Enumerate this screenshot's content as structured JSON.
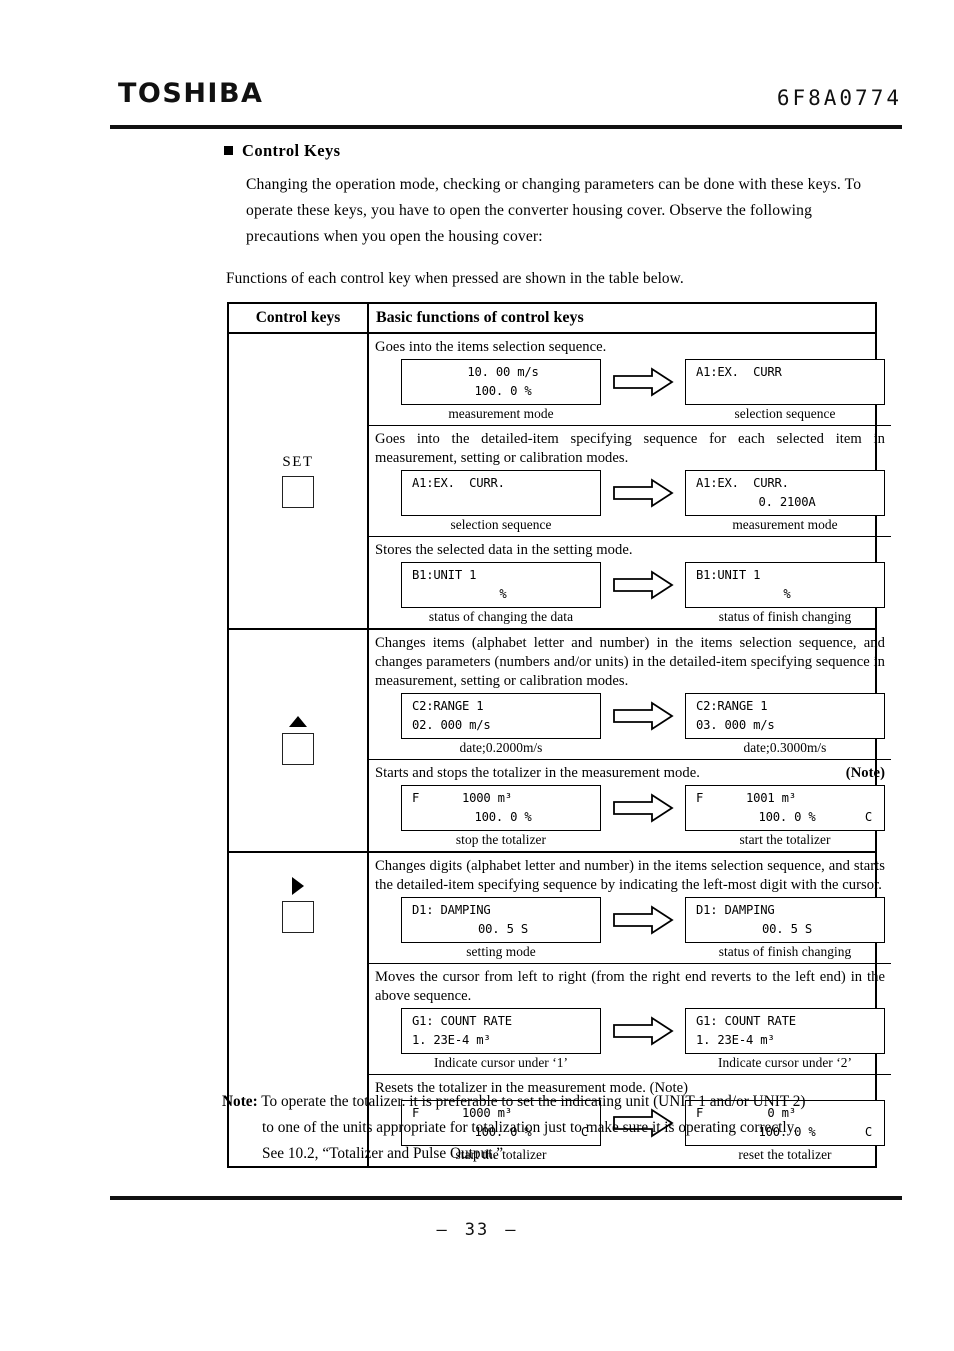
{
  "header": {
    "brand": "TOSHIBA",
    "doc_code": "6F8A0774"
  },
  "footer": {
    "page_number": "33",
    "dash_left": "—",
    "dash_right": "—"
  },
  "section": {
    "title": "Control Keys",
    "paragraph": "Changing the operation mode, checking or changing parameters can be done with these keys. To operate these keys, you have to open the converter housing cover. Observe the following precautions when you open the housing cover:",
    "lead_in": "Functions of each control key when pressed are shown in the table below."
  },
  "table": {
    "headers": {
      "left": "Control keys",
      "right": "Basic functions of control keys"
    },
    "rows": [
      {
        "key": {
          "label": "SET",
          "glyph": "box"
        },
        "subrows": [
          {
            "description": "Goes into the items selection sequence.",
            "note_tag": "",
            "before": {
              "line1": "10. 00 m/s",
              "line2": "100. 0 %",
              "indicator": "",
              "caption": "measurement mode"
            },
            "after": {
              "line1": "A1:EX.  CURR",
              "line2": "",
              "indicator": "",
              "caption": "selection sequence"
            }
          },
          {
            "description": "Goes into the detailed-item specifying sequence for each selected item in measurement, setting or calibration modes.",
            "note_tag": "",
            "before": {
              "line1": "A1:EX.  CURR.",
              "line2": "",
              "indicator": "",
              "caption": "selection sequence"
            },
            "after": {
              "line1": "A1:EX.  CURR.",
              "line2": "0. 2100A",
              "indicator": "",
              "caption": "measurement mode"
            }
          },
          {
            "description": "Stores the selected data in the setting mode.",
            "note_tag": "",
            "before": {
              "line1": "B1:UNIT 1",
              "line2": "%",
              "indicator": "",
              "caption": "status of changing the data"
            },
            "after": {
              "line1": "B1:UNIT 1",
              "line2": "%",
              "indicator": "",
              "caption": "status of finish changing"
            }
          }
        ]
      },
      {
        "key": {
          "label": "",
          "glyph": "triangle-up"
        },
        "subrows": [
          {
            "description": "Changes items (alphabet letter and number) in the items selection sequence, and changes parameters (numbers and/or units) in the detailed-item specifying sequence in measurement, setting or calibration modes.",
            "note_tag": "",
            "before": {
              "line1": "C2:RANGE 1",
              "line2": "02. 000 m/s",
              "indicator": "",
              "caption": "date;0.2000m/s"
            },
            "after": {
              "line1": "C2:RANGE 1",
              "line2": "03. 000 m/s",
              "indicator": "",
              "caption": "date;0.3000m/s"
            }
          },
          {
            "description": "Starts and stops the totalizer in the measurement mode.",
            "note_tag": "(Note)",
            "before": {
              "line1": "F      1000 m³",
              "line2": "100. 0 %",
              "indicator": "",
              "caption": "stop the totalizer"
            },
            "after": {
              "line1": "F      1001 m³",
              "line2": "100. 0 %",
              "indicator": "C",
              "caption": "start the totalizer"
            }
          }
        ]
      },
      {
        "key": {
          "label": "",
          "glyph": "triangle-right"
        },
        "subrows": [
          {
            "description": "Changes digits (alphabet letter and number) in the items selection sequence, and starts the detailed-item specifying sequence by indicating the left-most digit with the cursor.",
            "note_tag": "",
            "before": {
              "line1": "D1: DAMPING",
              "line2": "00. 5 S",
              "indicator": "",
              "caption": "setting mode"
            },
            "after": {
              "line1": "D1: DAMPING",
              "line2": "00. 5 S",
              "indicator": "",
              "caption": "status of finish changing"
            }
          },
          {
            "description": "Moves the cursor from left to right (from the right end reverts to the left end) in the above sequence.",
            "note_tag": "",
            "before": {
              "line1": "G1: COUNT RATE",
              "line2": "1. 23E-4 m³",
              "indicator": "",
              "caption": "Indicate cursor under ‘1’"
            },
            "after": {
              "line1": "G1: COUNT RATE",
              "line2": "1. 23E-4 m³",
              "indicator": "",
              "caption": "Indicate cursor under ‘2’"
            }
          },
          {
            "description": "Resets the totalizer in the measurement mode. (Note)",
            "note_tag": "",
            "before": {
              "line1": "F      1000 m³",
              "line2": "100. 0 %",
              "indicator": "C",
              "caption": "start the totalizer"
            },
            "after": {
              "line1": "F         0 m³",
              "line2": "100. 0 %",
              "indicator": "C",
              "caption": "reset the totalizer"
            }
          }
        ]
      }
    ]
  },
  "note": {
    "label": "Note:",
    "line1": "To operate the totalizer. it is preferable to set the indicating unit (UNIT 1 and/or UNIT 2)",
    "line2": "to one of the units appropriate for totalization just to make sure it is operating correctly.",
    "line3": "See 10.2, “Totalizer and Pulse Output.”"
  }
}
